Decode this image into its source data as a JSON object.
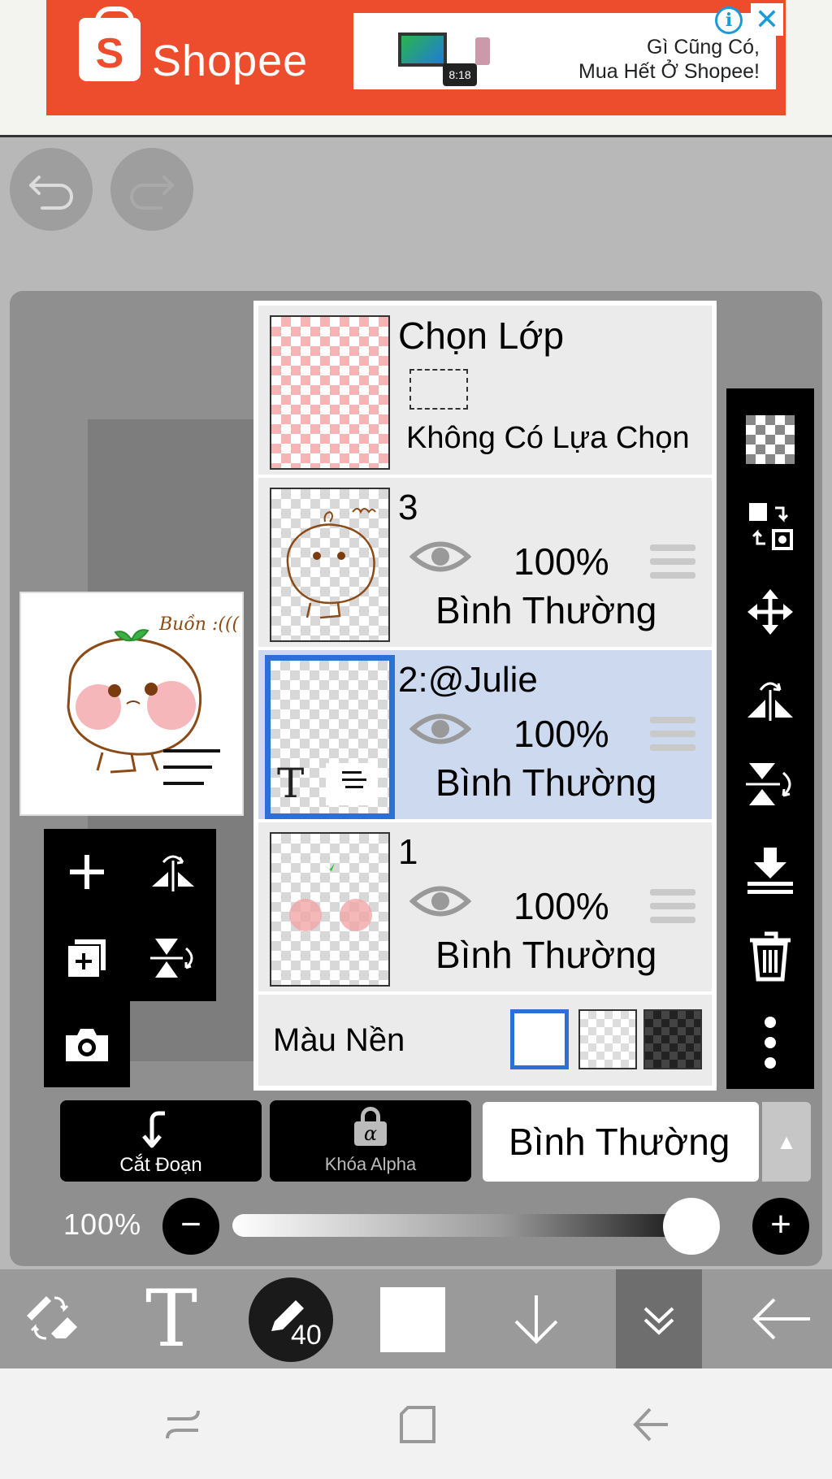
{
  "ad": {
    "brand": "Shopee",
    "line1": "Gì Cũng Có,",
    "line2": "Mua Hết Ở Shopee!",
    "clock_text": "8:18"
  },
  "toolbar_top": {
    "undo_icon": "undo-arrow-icon",
    "redo_icon": "redo-arrow-icon"
  },
  "layers": {
    "selection": {
      "title": "Chọn Lớp",
      "status": "Không Có Lựa Chọn"
    },
    "items": [
      {
        "name": "3",
        "opacity": "100%",
        "blend": "Bình Thường",
        "visible": true,
        "active": false
      },
      {
        "name": "2:@Julie",
        "opacity": "100%",
        "blend": "Bình Thường",
        "visible": true,
        "active": true,
        "thumb_glyph": "T"
      },
      {
        "name": "1",
        "opacity": "100%",
        "blend": "Bình Thường",
        "visible": true,
        "active": false
      }
    ],
    "background": {
      "label": "Màu Nền",
      "options": [
        "white",
        "transparent",
        "dark"
      ],
      "selected": "white"
    }
  },
  "preview": {
    "caption": "Buồn :((("
  },
  "actions": {
    "cut_label": "Cắt Đoạn",
    "alpha_lock_label": "Khóa Alpha",
    "alpha_symbol": "α",
    "blend_mode": "Bình Thường",
    "blend_arrow": "▲"
  },
  "opacity": {
    "label": "100%",
    "value": 1.0,
    "minus": "−",
    "plus": "+"
  },
  "bottom_toolbar": {
    "brush_size": "40",
    "text_tool": "T",
    "current_color": "#ffffff"
  },
  "colors": {
    "accent": "#2d6fd6",
    "active_row": "#ccd9ee",
    "shopee": "#ee4d2d"
  }
}
